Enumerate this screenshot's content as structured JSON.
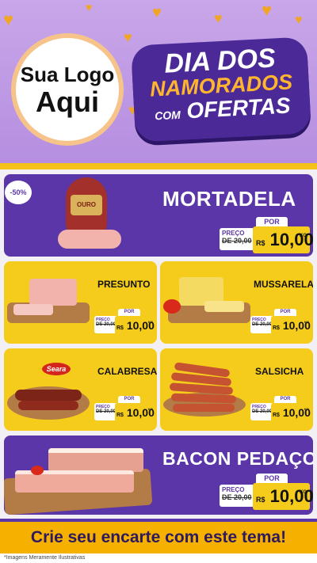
{
  "header": {
    "logo": {
      "line1": "Sua Logo",
      "line2": "Aqui"
    },
    "promo": {
      "line1": "DIA DOS",
      "line2": "NAMORADOS",
      "line3_small": "COM",
      "line3_big": "OFERTAS"
    }
  },
  "colors": {
    "purple": "#5b36a8",
    "yellow": "#f6cc1c",
    "header": "#c9a6e9",
    "accent": "#f4c21b"
  },
  "featured_badge": "-50%",
  "products": [
    {
      "id": "mortadela",
      "name": "MORTADELA",
      "por": "POR",
      "preco": "PREÇO",
      "old": "DE 20,00",
      "currency": "R$",
      "price": "10,00",
      "unit": "KG",
      "brand": "OURO"
    },
    {
      "id": "presunto",
      "name": "PRESUNTO",
      "por": "POR",
      "preco": "PREÇO",
      "old": "DE 20,00",
      "currency": "R$",
      "price": "10,00",
      "unit": "KG"
    },
    {
      "id": "mussarela",
      "name": "MUSSARELA",
      "por": "POR",
      "preco": "PREÇO",
      "old": "DE 20,00",
      "currency": "R$",
      "price": "10,00",
      "unit": "KG"
    },
    {
      "id": "calabresa",
      "name": "CALABRESA",
      "por": "POR",
      "preco": "PREÇO",
      "old": "DE 20,00",
      "currency": "R$",
      "price": "10,00",
      "unit": "KG",
      "brand": "Seara"
    },
    {
      "id": "salsicha",
      "name": "SALSICHA",
      "por": "POR",
      "preco": "PREÇO",
      "old": "DE 20,00",
      "currency": "R$",
      "price": "10,00",
      "unit": "KG"
    },
    {
      "id": "bacon",
      "name": "BACON PEDAÇO",
      "por": "POR",
      "preco": "PREÇO",
      "old": "DE 20,00",
      "currency": "R$",
      "price": "10,00",
      "unit": "KG"
    }
  ],
  "cta": "Crie seu encarte com este tema!",
  "footer": "*Imagens Meramente Ilustrativas"
}
